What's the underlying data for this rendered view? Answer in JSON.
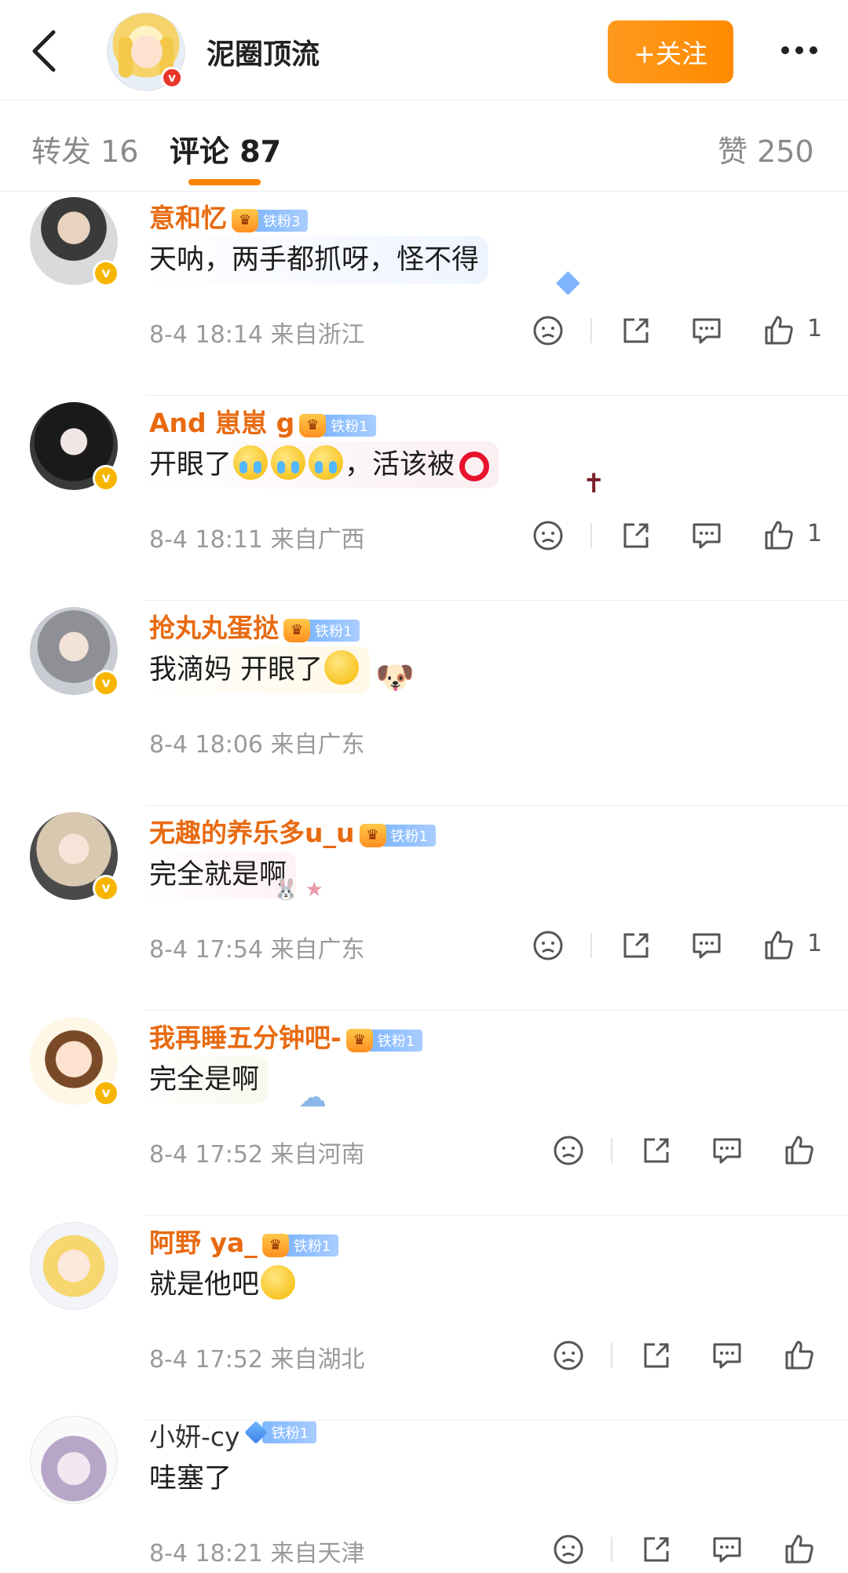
{
  "header": {
    "title": "泥圈顶流",
    "follow_label": "+关注"
  },
  "tabs": {
    "repost": "转发 16",
    "comments": "评论 87",
    "likes": "赞 250"
  },
  "colors": {
    "accent": "#ff8200",
    "username": "#e86a10",
    "meta": "#9a9a9a",
    "fan_badge": "#7eb6ff"
  },
  "comments": [
    {
      "user": "意和忆",
      "badge": "铁粉3",
      "text": "天呐，两手都抓呀，怪不得",
      "meta": "8-4 18:14 来自浙江",
      "likes": "1"
    },
    {
      "user": "And 崽崽 g",
      "badge": "铁粉1",
      "text": "开眼了",
      "text2": "，活该被",
      "meta": "8-4 18:11 来自广西",
      "likes": "1"
    },
    {
      "user": "抢丸丸蛋挞",
      "badge": "铁粉1",
      "text": "我滴妈 开眼了",
      "meta": "8-4 18:06 来自广东",
      "likes": ""
    },
    {
      "user": "无趣的养乐多u_u",
      "badge": "铁粉1",
      "text": "完全就是啊",
      "meta": "8-4 17:54 来自广东",
      "likes": "1"
    },
    {
      "user": "我再睡五分钟吧-",
      "badge": "铁粉1",
      "text": "完全是啊",
      "meta": "8-4 17:52 来自河南",
      "likes": ""
    },
    {
      "user": "阿野 ya_",
      "badge": "铁粉1",
      "text": "就是他吧",
      "meta": "8-4 17:52 来自湖北",
      "likes": ""
    },
    {
      "user": "小妍-cy",
      "badge": "铁粉1",
      "text": "哇塞了",
      "meta": "8-4 18:21 来自天津",
      "likes": ""
    }
  ]
}
